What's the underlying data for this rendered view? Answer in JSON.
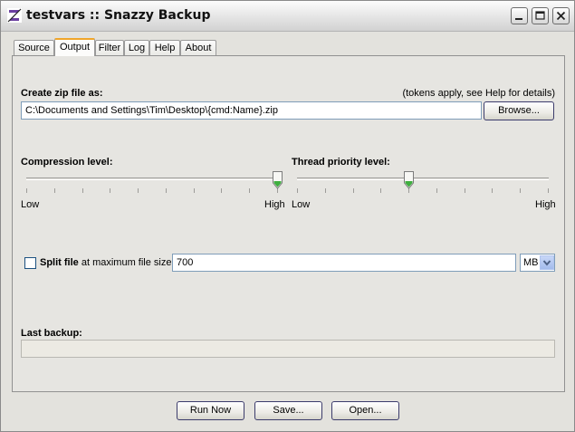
{
  "window": {
    "title": "testvars :: Snazzy Backup",
    "icon": "snazzy-backup-z-icon"
  },
  "tabs": [
    {
      "label": "Source",
      "active": false
    },
    {
      "label": "Output",
      "active": true
    },
    {
      "label": "Filter",
      "active": false
    },
    {
      "label": "Log",
      "active": false
    },
    {
      "label": "Help",
      "active": false
    },
    {
      "label": "About",
      "active": false
    }
  ],
  "output": {
    "zip_label": "Create zip file as:",
    "zip_hint": "(tokens apply, see Help for details)",
    "zip_path": "C:\\Documents and Settings\\Tim\\Desktop\\{cmd:Name}.zip",
    "browse_label": "Browse...",
    "compression": {
      "label": "Compression level:",
      "low": "Low",
      "high": "High",
      "value_fraction": 1.0,
      "ticks": 10
    },
    "thread_priority": {
      "label": "Thread priority level:",
      "low": "Low",
      "high": "High",
      "value_fraction": 0.4444,
      "ticks": 10
    },
    "split": {
      "checked": false,
      "label_bold": "Split file",
      "label_rest": "at maximum file size:",
      "size_value": "700",
      "unit": "MB"
    },
    "last_backup_label": "Last backup:",
    "last_backup_progress": 0
  },
  "footer": {
    "run_now": "Run Now",
    "save": "Save...",
    "open": "Open..."
  },
  "colors": {
    "active_tab_accent": "#f0a62a",
    "thumb_accent": "#3fae3f",
    "input_border": "#7f9db9"
  }
}
